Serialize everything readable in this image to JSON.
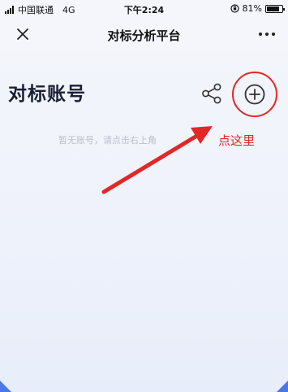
{
  "status_bar": {
    "carrier": "中国联通",
    "network": "4G",
    "time": "下午2:24",
    "battery": "81%",
    "battery_level": 0.81
  },
  "navbar": {
    "title": "对标分析平台",
    "close_icon": "close-icon",
    "more_icon": "more-dots-icon"
  },
  "main": {
    "title": "对标账号",
    "empty_hint": "暂无账号，请点击右上角",
    "share_icon": "share-icon",
    "add_icon": "add-circle-icon"
  },
  "annotation": {
    "text": "点这里",
    "color": "#e32727"
  },
  "colors": {
    "accent_blue": "#4a78e6",
    "annotation_red": "#e32727"
  }
}
